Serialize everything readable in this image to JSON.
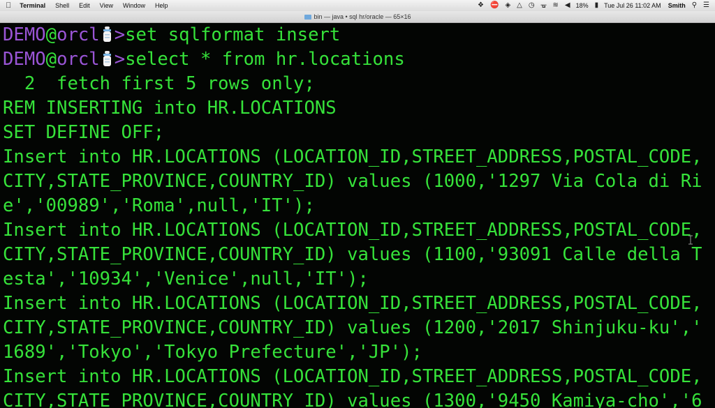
{
  "menubar": {
    "app_name": "Terminal",
    "menus": [
      "Shell",
      "Edit",
      "View",
      "Window",
      "Help"
    ],
    "battery": "18%",
    "datetime": "Tue Jul 26  11:02 AM",
    "user": "Smith",
    "icons": [
      "apple-icon",
      "dropbox-icon",
      "no-entry-icon",
      "evernote-icon",
      "airplay-icon",
      "time-machine-icon",
      "bluetooth-icon",
      "wifi-icon",
      "volume-icon",
      "battery-icon",
      "spotlight-icon",
      "list-icon"
    ]
  },
  "window": {
    "title": "bin — java • sql hr/oracle — 65×16"
  },
  "terminal": {
    "prompt_user": "DEMO",
    "prompt_at": "@",
    "prompt_host": "orcl",
    "prompt_symbol": ">",
    "lines": [
      "set sqlformat insert",
      "select * from hr.locations",
      "  2  fetch first 5 rows only;",
      "REM INSERTING into HR.LOCATIONS",
      "SET DEFINE OFF;",
      "Insert into HR.LOCATIONS (LOCATION_ID,STREET_ADDRESS,POSTAL_CODE,",
      "CITY,STATE_PROVINCE,COUNTRY_ID) values (1000,'1297 Via Cola di Ri",
      "e','00989','Roma',null,'IT');",
      "Insert into HR.LOCATIONS (LOCATION_ID,STREET_ADDRESS,POSTAL_CODE,",
      "CITY,STATE_PROVINCE,COUNTRY_ID) values (1100,'93091 Calle della T",
      "esta','10934','Venice',null,'IT');",
      "Insert into HR.LOCATIONS (LOCATION_ID,STREET_ADDRESS,POSTAL_CODE,",
      "CITY,STATE_PROVINCE,COUNTRY_ID) values (1200,'2017 Shinjuku-ku','",
      "1689','Tokyo','Tokyo Prefecture','JP');",
      "Insert into HR.LOCATIONS (LOCATION_ID,STREET_ADDRESS,POSTAL_CODE,",
      "CITY,STATE_PROVINCE,COUNTRY_ID) values (1300,'9450 Kamiya-cho','6"
    ],
    "colors": {
      "text": "#36e23a",
      "prompt": "#9a55d6",
      "background": "#030503"
    }
  }
}
